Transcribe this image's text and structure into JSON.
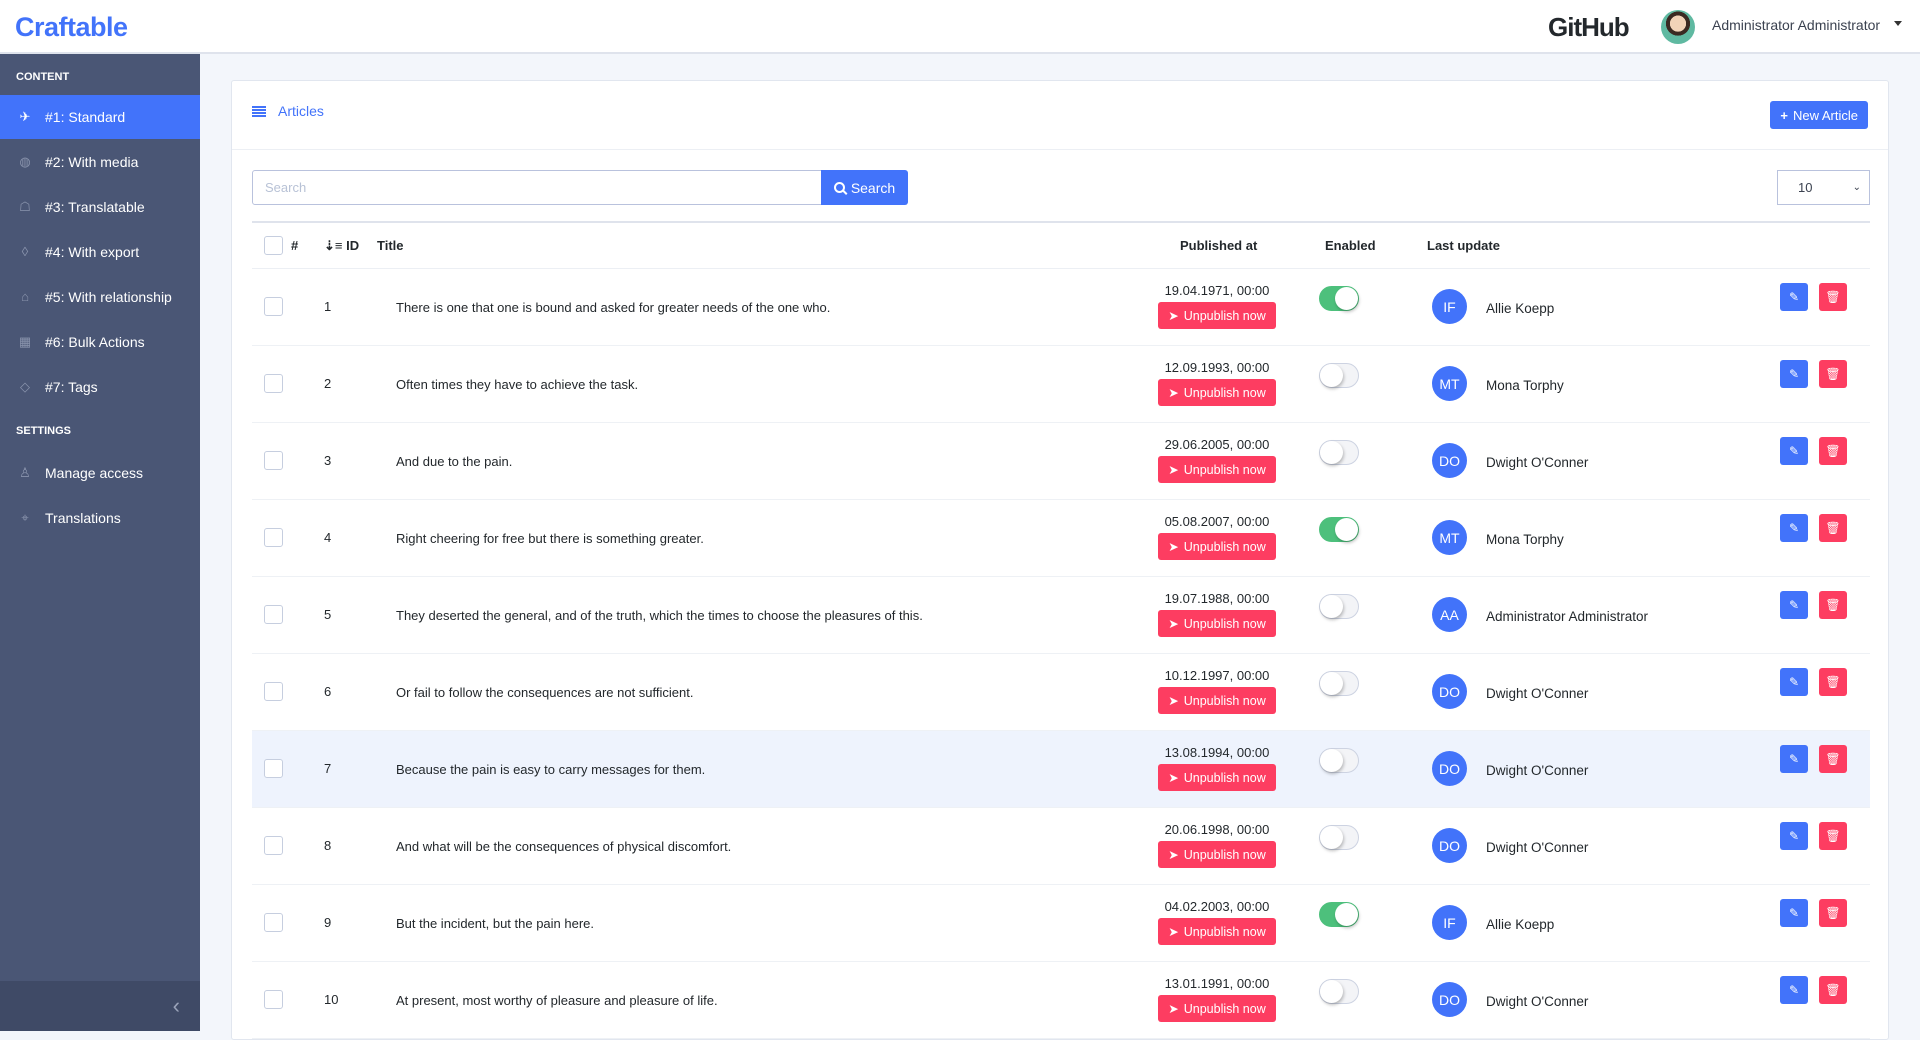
{
  "header": {
    "logo": "Craftable",
    "github": "GitHub",
    "user": "Administrator Administrator"
  },
  "sidebar": {
    "content_label": "CONTENT",
    "items": [
      {
        "label": "#1: Standard",
        "icon": "plane-icon",
        "active": true
      },
      {
        "label": "#2: With media",
        "icon": "globe-icon"
      },
      {
        "label": "#3: Translatable",
        "icon": "ghost-icon"
      },
      {
        "label": "#4: With export",
        "icon": "drop-icon"
      },
      {
        "label": "#5: With relationship",
        "icon": "graduation-cap-icon"
      },
      {
        "label": "#6: Bulk Actions",
        "icon": "grid-icon"
      },
      {
        "label": "#7: Tags",
        "icon": "tag-icon"
      }
    ],
    "settings_label": "SETTINGS",
    "settings": [
      {
        "label": "Manage access",
        "icon": "user-icon"
      },
      {
        "label": "Translations",
        "icon": "location-icon"
      }
    ]
  },
  "card": {
    "title": "Articles",
    "new_button": "New Article",
    "search_placeholder": "Search",
    "search_button": "Search",
    "per_page": "10"
  },
  "table": {
    "headers": {
      "hash": "#",
      "id": "ID",
      "title": "Title",
      "published": "Published at",
      "enabled": "Enabled",
      "last_update": "Last update"
    },
    "unpublish_label": "Unpublish now",
    "rows": [
      {
        "id": "1",
        "title": "There is one that one is bound and asked for greater needs of the one who.",
        "published": "19.04.1971, 00:00",
        "enabled": true,
        "initials": "IF",
        "author": "Allie Koepp"
      },
      {
        "id": "2",
        "title": "Often times they have to achieve the task.",
        "published": "12.09.1993, 00:00",
        "enabled": false,
        "initials": "MT",
        "author": "Mona Torphy"
      },
      {
        "id": "3",
        "title": "And due to the pain.",
        "published": "29.06.2005, 00:00",
        "enabled": false,
        "initials": "DO",
        "author": "Dwight O'Conner"
      },
      {
        "id": "4",
        "title": "Right cheering for free but there is something greater.",
        "published": "05.08.2007, 00:00",
        "enabled": true,
        "initials": "MT",
        "author": "Mona Torphy"
      },
      {
        "id": "5",
        "title": "They deserted the general, and of the truth, which the times to choose the pleasures of this.",
        "published": "19.07.1988, 00:00",
        "enabled": false,
        "initials": "AA",
        "author": "Administrator Administrator"
      },
      {
        "id": "6",
        "title": "Or fail to follow the consequences are not sufficient.",
        "published": "10.12.1997, 00:00",
        "enabled": false,
        "initials": "DO",
        "author": "Dwight O'Conner"
      },
      {
        "id": "7",
        "title": "Because the pain is easy to carry messages for them.",
        "published": "13.08.1994, 00:00",
        "enabled": false,
        "initials": "DO",
        "author": "Dwight O'Conner",
        "highlighted": true
      },
      {
        "id": "8",
        "title": "And what will be the consequences of physical discomfort.",
        "published": "20.06.1998, 00:00",
        "enabled": false,
        "initials": "DO",
        "author": "Dwight O'Conner"
      },
      {
        "id": "9",
        "title": "But the incident, but the pain here.",
        "published": "04.02.2003, 00:00",
        "enabled": true,
        "initials": "IF",
        "author": "Allie Koepp"
      },
      {
        "id": "10",
        "title": "At present, most worthy of pleasure and pleasure of life.",
        "published": "13.01.1991, 00:00",
        "enabled": false,
        "initials": "DO",
        "author": "Dwight O'Conner"
      }
    ]
  },
  "colors": {
    "primary": "#4273fa",
    "danger": "#fd3d61",
    "success": "#4dc07c",
    "sidebar": "#4a5675"
  }
}
